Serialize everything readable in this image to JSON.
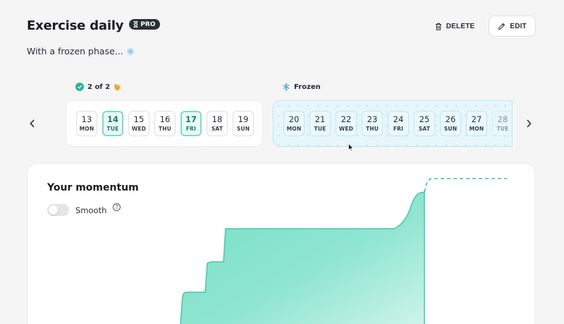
{
  "header": {
    "title": "Exercise daily",
    "badge": "PRO",
    "subtitle": "With a frozen phase...",
    "subtitle_icon": "snowflake-icon"
  },
  "actions": {
    "delete_label": "DELETE",
    "edit_label": "EDIT"
  },
  "completed_week": {
    "status": "2 of 2",
    "days": [
      {
        "num": "13",
        "dow": "MON",
        "done": false
      },
      {
        "num": "14",
        "dow": "TUE",
        "done": true
      },
      {
        "num": "15",
        "dow": "WED",
        "done": false
      },
      {
        "num": "16",
        "dow": "THU",
        "done": false
      },
      {
        "num": "17",
        "dow": "FRI",
        "done": true
      },
      {
        "num": "18",
        "dow": "SAT",
        "done": false
      },
      {
        "num": "19",
        "dow": "SUN",
        "done": false
      }
    ]
  },
  "frozen_week": {
    "label": "Frozen",
    "days": [
      {
        "num": "20",
        "dow": "MON"
      },
      {
        "num": "21",
        "dow": "TUE"
      },
      {
        "num": "22",
        "dow": "WED"
      },
      {
        "num": "23",
        "dow": "THU"
      },
      {
        "num": "24",
        "dow": "FRI"
      },
      {
        "num": "25",
        "dow": "SAT"
      },
      {
        "num": "26",
        "dow": "SUN"
      },
      {
        "num": "27",
        "dow": "MON"
      },
      {
        "num": "28",
        "dow": "TUE"
      }
    ]
  },
  "momentum": {
    "title": "Your momentum",
    "smooth_label": "Smooth",
    "smooth_on": false,
    "help": "?"
  },
  "colors": {
    "accent": "#2bb39b",
    "area_fill": "#7fe0c9",
    "frozen_bg": "#e6f6fb"
  }
}
